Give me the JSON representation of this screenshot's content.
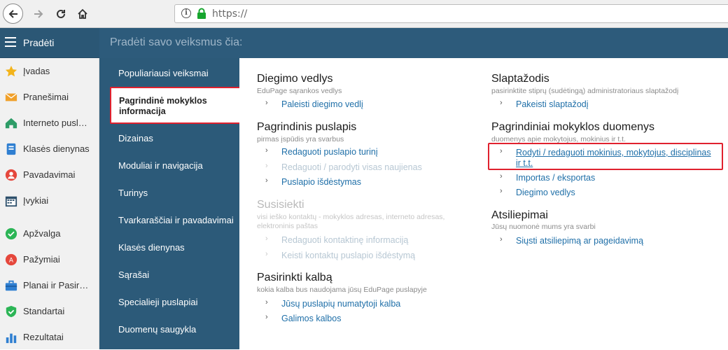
{
  "browser": {
    "url": "https://",
    "back_icon": "arrow-left-icon",
    "forward_icon": "arrow-right-icon",
    "reload_icon": "reload-icon",
    "home_icon": "home-icon"
  },
  "topbar": {
    "menu_label": "Pradėti",
    "prompt": "Pradėti savo veiksmus čia:",
    "color": "#2b5775"
  },
  "sidebar": {
    "items": [
      {
        "label": "Įvadas",
        "icon": "star-icon"
      },
      {
        "label": "Pranešimai",
        "icon": "envelope-icon"
      },
      {
        "label": "Interneto pusl…",
        "icon": "house-icon"
      },
      {
        "label": "Klasės dienynas",
        "icon": "book-icon"
      },
      {
        "label": "Pavadavimai",
        "icon": "person-icon"
      },
      {
        "label": "Įvykiai",
        "icon": "calendar-icon"
      },
      {
        "label": "Apžvalga",
        "icon": "check-circle-icon"
      },
      {
        "label": "Pažymiai",
        "icon": "grade-icon"
      },
      {
        "label": "Planai ir Pasir…",
        "icon": "briefcase-icon"
      },
      {
        "label": "Standartai",
        "icon": "shield-check-icon"
      },
      {
        "label": "Rezultatai",
        "icon": "bar-chart-icon"
      }
    ]
  },
  "subnav": {
    "items": [
      "Populiariausi veiksmai",
      "Pagrindinė mokyklos informacija",
      "Dizainas",
      "Moduliai ir navigacija",
      "Turinys",
      "Tvarkaraščiai ir pavadavimai",
      "Klasės dienynas",
      "Sąrašai",
      "Specialieji puslapiai",
      "Duomenų saugykla"
    ],
    "active_line1": "Pagrindinė mokyklos",
    "active_line2": "informacija"
  },
  "sections": {
    "diegimo": {
      "title": "Diegimo vedlys",
      "subtitle": "EduPage sąrankos vedlys",
      "links": [
        "Paleisti diegimo vedlį"
      ]
    },
    "pagrindinis": {
      "title": "Pagrindinis puslapis",
      "subtitle": "pirmas įspūdis yra svarbus",
      "links": [
        "Redaguoti puslapio turinį",
        "Redaguoti / parodyti visas naujienas",
        "Puslapio išdėstymas"
      ]
    },
    "susisiekti": {
      "title": "Susisiekti",
      "subtitle_line1": "visi ieško kontaktų - mokyklos adresas, interneto adresas,",
      "subtitle_line2": "elektroninis paštas",
      "links": [
        "Redaguoti kontaktinę informaciją",
        "Keisti kontaktų puslapio išdėstymą"
      ]
    },
    "kalba": {
      "title": "Pasirinkti kalbą",
      "subtitle": "kokia kalba bus naudojama jūsų EduPage puslapyje",
      "links": [
        "Jūsų puslapių numatytoji kalba",
        "Galimos kalbos"
      ]
    },
    "slaptazodis": {
      "title": "Slaptažodis",
      "subtitle": "pasirinktite stiprų (sudėtingą) administratoriaus slaptažodį",
      "links": [
        "Pakeisti slaptažodį"
      ]
    },
    "duomenys": {
      "title": "Pagrindiniai mokyklos duomenys",
      "subtitle": "duomenys apie mokytojus, mokinius ir t.t.",
      "highlight_line1": "Rodyti / redaguoti mokinius, mokytojus, disciplinas",
      "highlight_line2": "ir t.t.",
      "links": [
        "Importas / eksportas",
        "Diegimo vedlys"
      ]
    },
    "atsiliepimai": {
      "title": "Atsiliepimai",
      "subtitle": "Jūsų nuomonė mums yra svarbi",
      "links": [
        "Siųsti atsiliepimą ar pageidavimą"
      ]
    }
  },
  "colors": {
    "highlight": "#e0212e",
    "link": "#1f6fa8",
    "subnav_bg": "#2c5a79"
  }
}
